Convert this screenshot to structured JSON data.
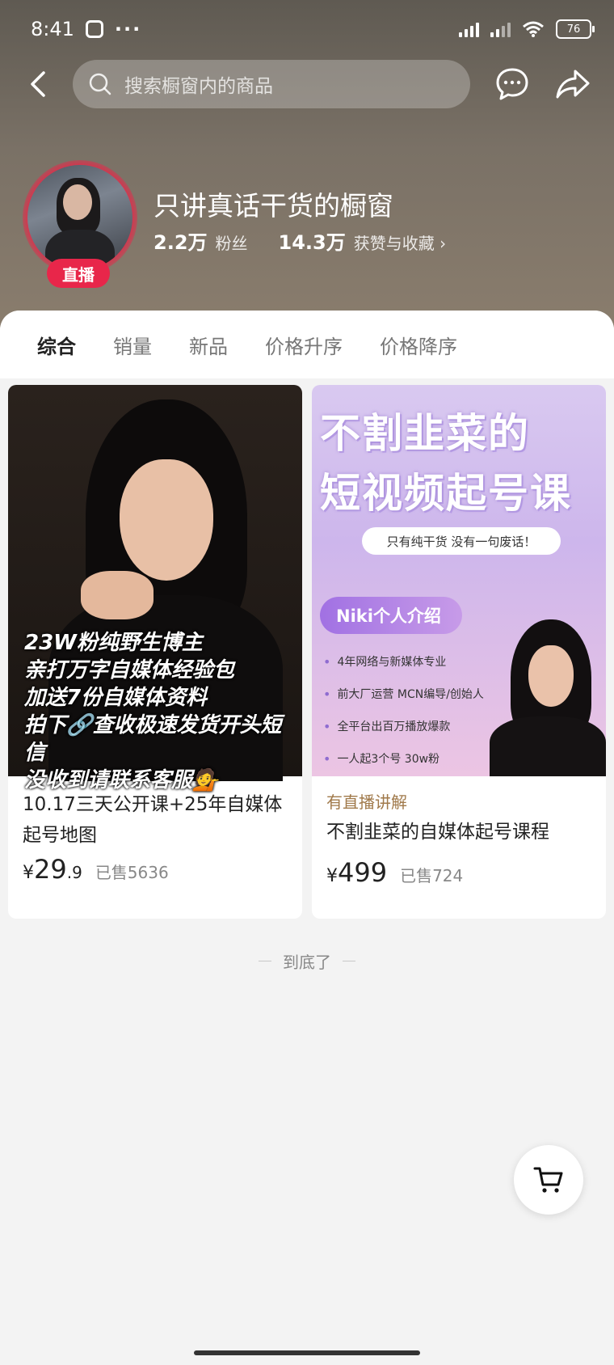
{
  "status": {
    "time": "8:41",
    "dots": "···",
    "battery": "76"
  },
  "search": {
    "placeholder": "搜索橱窗内的商品"
  },
  "shop": {
    "name": "只讲真话干货的橱窗",
    "live": "直播",
    "fans_num": "2.2万",
    "fans_label": "粉丝",
    "likes_num": "14.3万",
    "likes_label": "获赞与收藏 ›"
  },
  "tabs": [
    "综合",
    "销量",
    "新品",
    "价格升序",
    "价格降序"
  ],
  "products": [
    {
      "overlay_lines": [
        "23W粉纯野生博主",
        "亲打万字自媒体经验包",
        "加送7份自媒体资料",
        "拍下🔗查收极速发货开头短信",
        "没收到请联系客服💁"
      ],
      "title": "10.17三天公开课+25年自媒体起号地图",
      "price_yen": "¥",
      "price_int": "29",
      "price_dec": ".9",
      "sold": "已售5636"
    },
    {
      "img_title1": "不割韭菜的",
      "img_title2": "短视频起号课",
      "img_pill": "只有纯干货 没有一句废话！",
      "img_badge": "Niki个人介绍",
      "img_bullets": [
        "4年网络与新媒体专业",
        "前大厂运营 MCN编导/创始人",
        "全平台出百万播放爆款",
        "一人起3个号 30w粉"
      ],
      "tag": "有直播讲解",
      "title": "不割韭菜的自媒体起号课程",
      "price_yen": "¥",
      "price_int": "499",
      "price_dec": "",
      "sold": "已售724"
    }
  ],
  "end_text": "到底了",
  "icons": {
    "back": "back-arrow-icon",
    "search": "search-icon",
    "chat": "chat-bubble-icon",
    "share": "share-icon",
    "cart": "cart-icon"
  }
}
